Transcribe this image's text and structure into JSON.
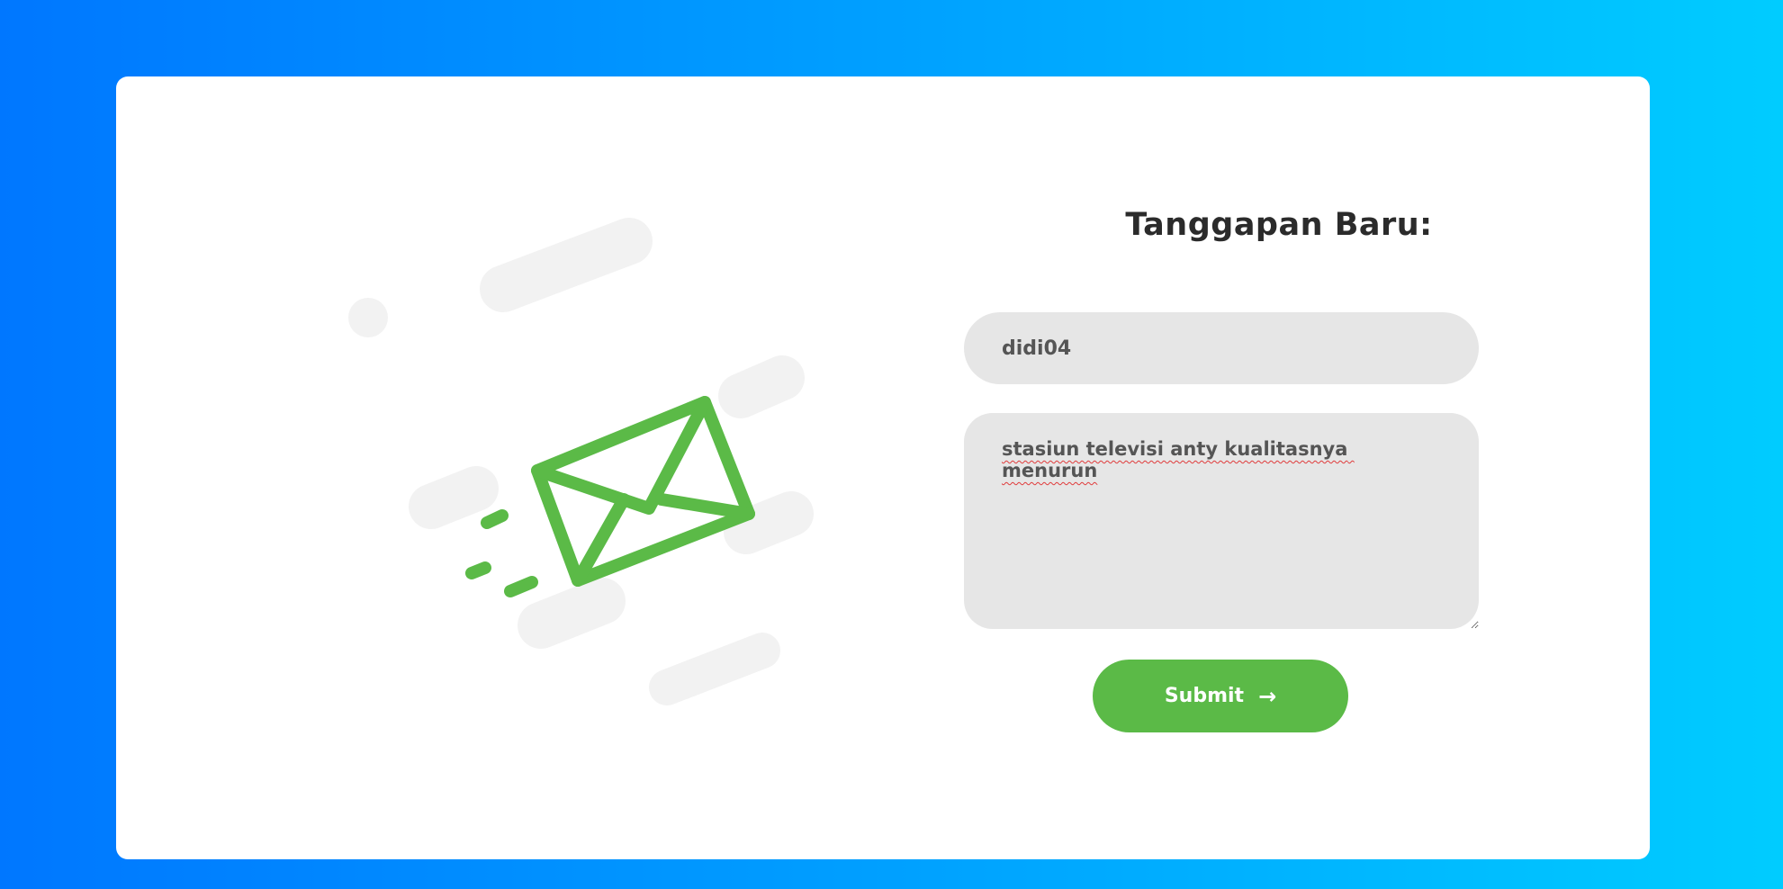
{
  "form": {
    "title": "Tanggapan Baru:",
    "name_value": "didi04",
    "response_value": "stasiun televisi anty kualitasnya menurun",
    "submit_label": "Submit",
    "submit_icon": "→"
  },
  "illustration": {
    "icon": "envelope-icon",
    "icon_color": "#5bba47",
    "decor_color": "#f2f2f2"
  },
  "colors": {
    "background_start": "#0077ff",
    "background_end": "#00ccff",
    "accent": "#5bba47",
    "field_bg": "#e6e6e6"
  }
}
